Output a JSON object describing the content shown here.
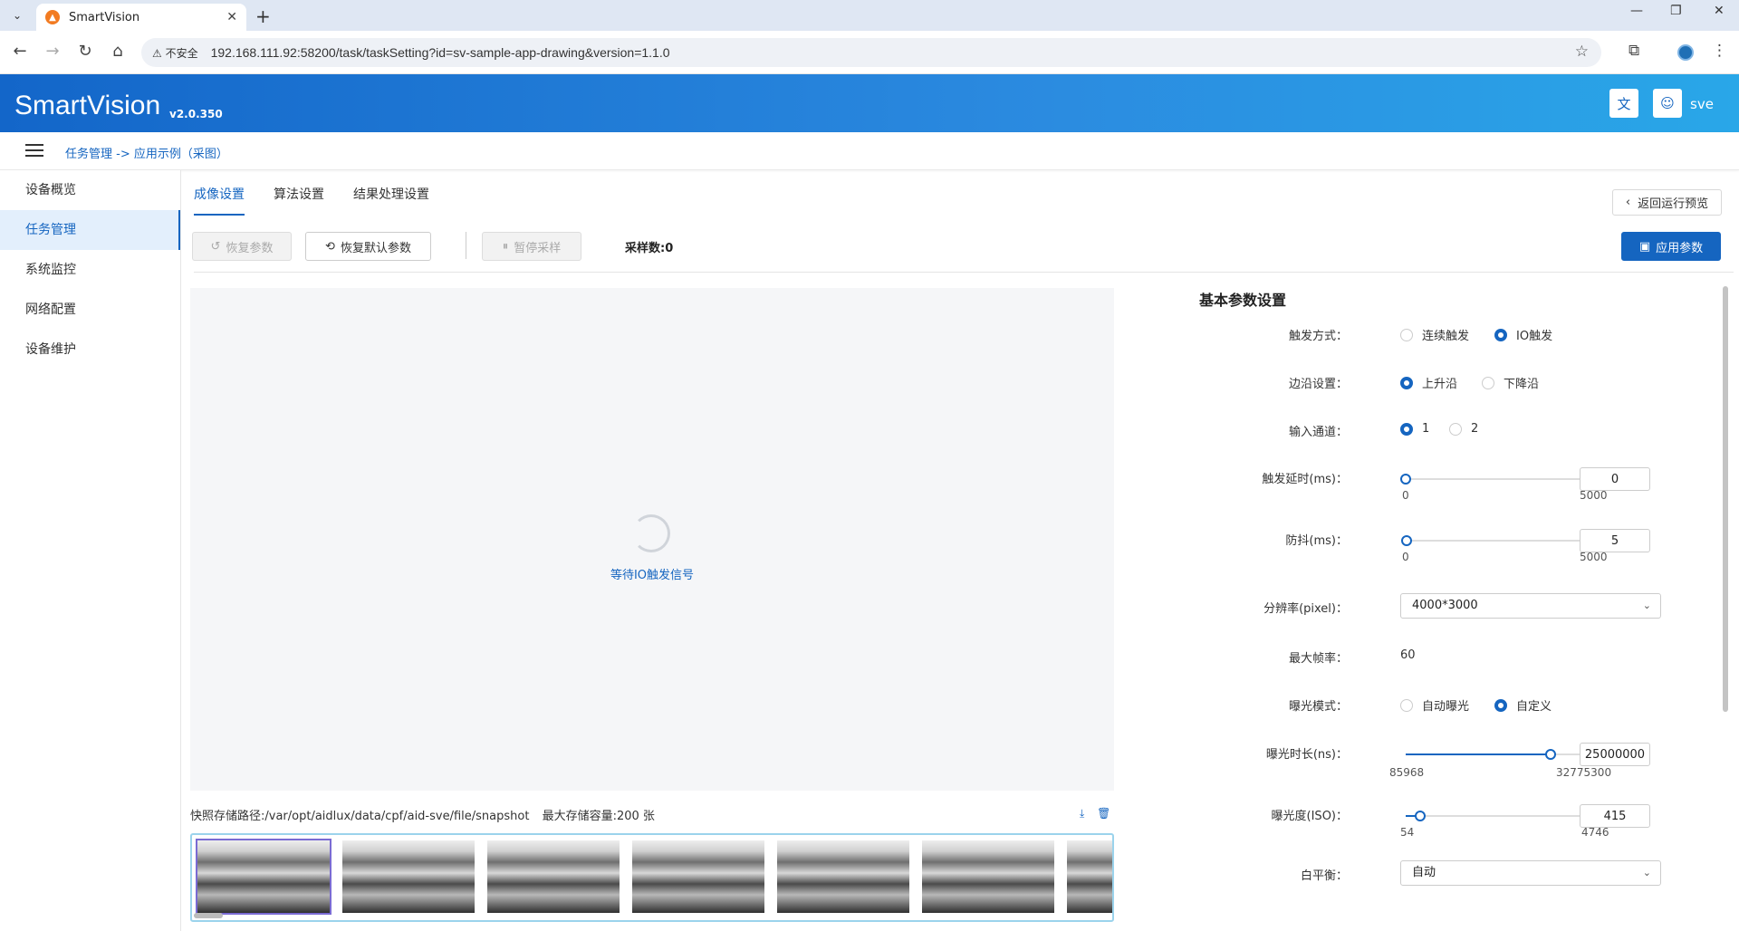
{
  "browser": {
    "tab_title": "SmartVision",
    "insecure_label": "不安全",
    "url": "192.168.111.92:58200/task/taskSetting?id=sv-sample-app-drawing&version=1.1.0"
  },
  "header": {
    "brand": "SmartVision",
    "version": "v2.0.350",
    "user": "sve"
  },
  "breadcrumb": "任务管理 -> 应用示例（采图）",
  "sidebar": {
    "items": [
      {
        "label": "设备概览"
      },
      {
        "label": "任务管理"
      },
      {
        "label": "系统监控"
      },
      {
        "label": "网络配置"
      },
      {
        "label": "设备维护"
      }
    ]
  },
  "tabs": [
    {
      "label": "成像设置"
    },
    {
      "label": "算法设置"
    },
    {
      "label": "结果处理设置"
    }
  ],
  "back_button": "返回运行预览",
  "toolbar": {
    "restore": "恢复参数",
    "restore_default": "恢复默认参数",
    "pause": "暂停采样",
    "sample_count": "采样数:0",
    "apply": "应用参数"
  },
  "preview": {
    "waiting": "等待IO触发信号"
  },
  "snapshot": {
    "path": "快照存储路径:/var/opt/aidlux/data/cpf/aid-sve/file/snapshot",
    "capacity": "最大存储容量:200 张"
  },
  "params": {
    "title": "基本参数设置",
    "trigger_mode": {
      "label": "触发方式：",
      "options": [
        "连续触发",
        "IO触发"
      ],
      "selected": "IO触发"
    },
    "edge": {
      "label": "边沿设置：",
      "options": [
        "上升沿",
        "下降沿"
      ],
      "selected": "上升沿"
    },
    "channel": {
      "label": "输入通道：",
      "options": [
        "1",
        "2"
      ],
      "selected": "1"
    },
    "trigger_delay": {
      "label": "触发延时(ms)：",
      "min": "0",
      "max": "5000",
      "value": "0"
    },
    "debounce": {
      "label": "防抖(ms)：",
      "min": "0",
      "max": "5000",
      "value": "5"
    },
    "resolution": {
      "label": "分辨率(pixel)：",
      "value": "4000*3000"
    },
    "max_fps": {
      "label": "最大帧率：",
      "value": "60"
    },
    "exposure_mode": {
      "label": "曝光模式：",
      "options": [
        "自动曝光",
        "自定义"
      ],
      "selected": "自定义"
    },
    "exposure_time": {
      "label": "曝光时长(ns)：",
      "min": "85968",
      "max": "32775300",
      "value": "25000000"
    },
    "iso": {
      "label": "曝光度(ISO)：",
      "min": "54",
      "max": "4746",
      "value": "415"
    },
    "white_balance": {
      "label": "白平衡：",
      "value": "自动"
    }
  },
  "colors": {
    "primary": "#1565c0",
    "header_start": "#1366c9",
    "header_end": "#29a7e8"
  }
}
